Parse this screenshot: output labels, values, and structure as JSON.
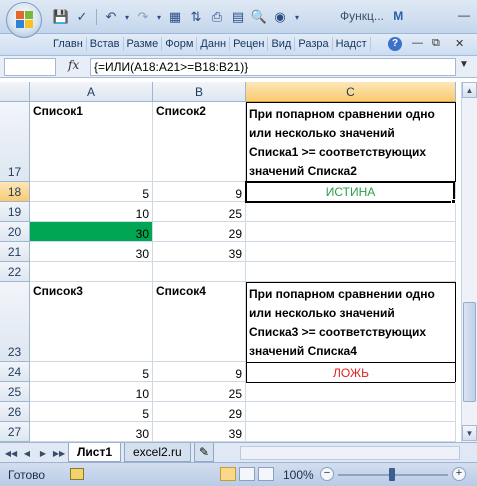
{
  "window": {
    "title": "Функц...",
    "app_letter": "M"
  },
  "qat": {
    "save_icon": "save-icon",
    "undo_icon": "undo-icon",
    "redo_icon": "redo-icon"
  },
  "ribbon": {
    "tabs": [
      "Главн",
      "Встав",
      "Разме",
      "Форм",
      "Данн",
      "Рецен",
      "Вид",
      "Разра",
      "Надст"
    ]
  },
  "formula_bar": {
    "name_box": "",
    "fx": "fx",
    "formula": "{=ИЛИ(A18:A21>=B18:B21)}"
  },
  "columns": [
    "A",
    "B",
    "C"
  ],
  "rows": {
    "r17": {
      "num": "17",
      "a": "Список1",
      "b": "Список2",
      "c_lines": [
        "При попарном сравнении одно",
        "или несколько значений",
        "Списка1 >= соответствующих",
        "значений Списка2"
      ]
    },
    "r18": {
      "num": "18",
      "a": "5",
      "b": "9",
      "c": "ИСТИНА"
    },
    "r19": {
      "num": "19",
      "a": "10",
      "b": "25"
    },
    "r20": {
      "num": "20",
      "a": "30",
      "b": "29"
    },
    "r21": {
      "num": "21",
      "a": "30",
      "b": "39"
    },
    "r22": {
      "num": "22"
    },
    "r23": {
      "num": "23",
      "a": "Список3",
      "b": "Список4",
      "c_lines": [
        "При попарном сравнении одно",
        "или несколько значений",
        "Списка3 >= соответствующих",
        "значений Списка4"
      ]
    },
    "r24": {
      "num": "24",
      "a": "5",
      "b": "9",
      "c": "ЛОЖЬ"
    },
    "r25": {
      "num": "25",
      "a": "10",
      "b": "25"
    },
    "r26": {
      "num": "26",
      "a": "5",
      "b": "29"
    },
    "r27": {
      "num": "27",
      "a": "30",
      "b": "39"
    }
  },
  "colors": {
    "true_text": "#2e9e4a",
    "false_text": "#e02020",
    "highlight_fill": "#00a651"
  },
  "sheets": [
    "Лист1",
    "excel2.ru"
  ],
  "status": {
    "ready": "Готово",
    "zoom": "100%"
  }
}
